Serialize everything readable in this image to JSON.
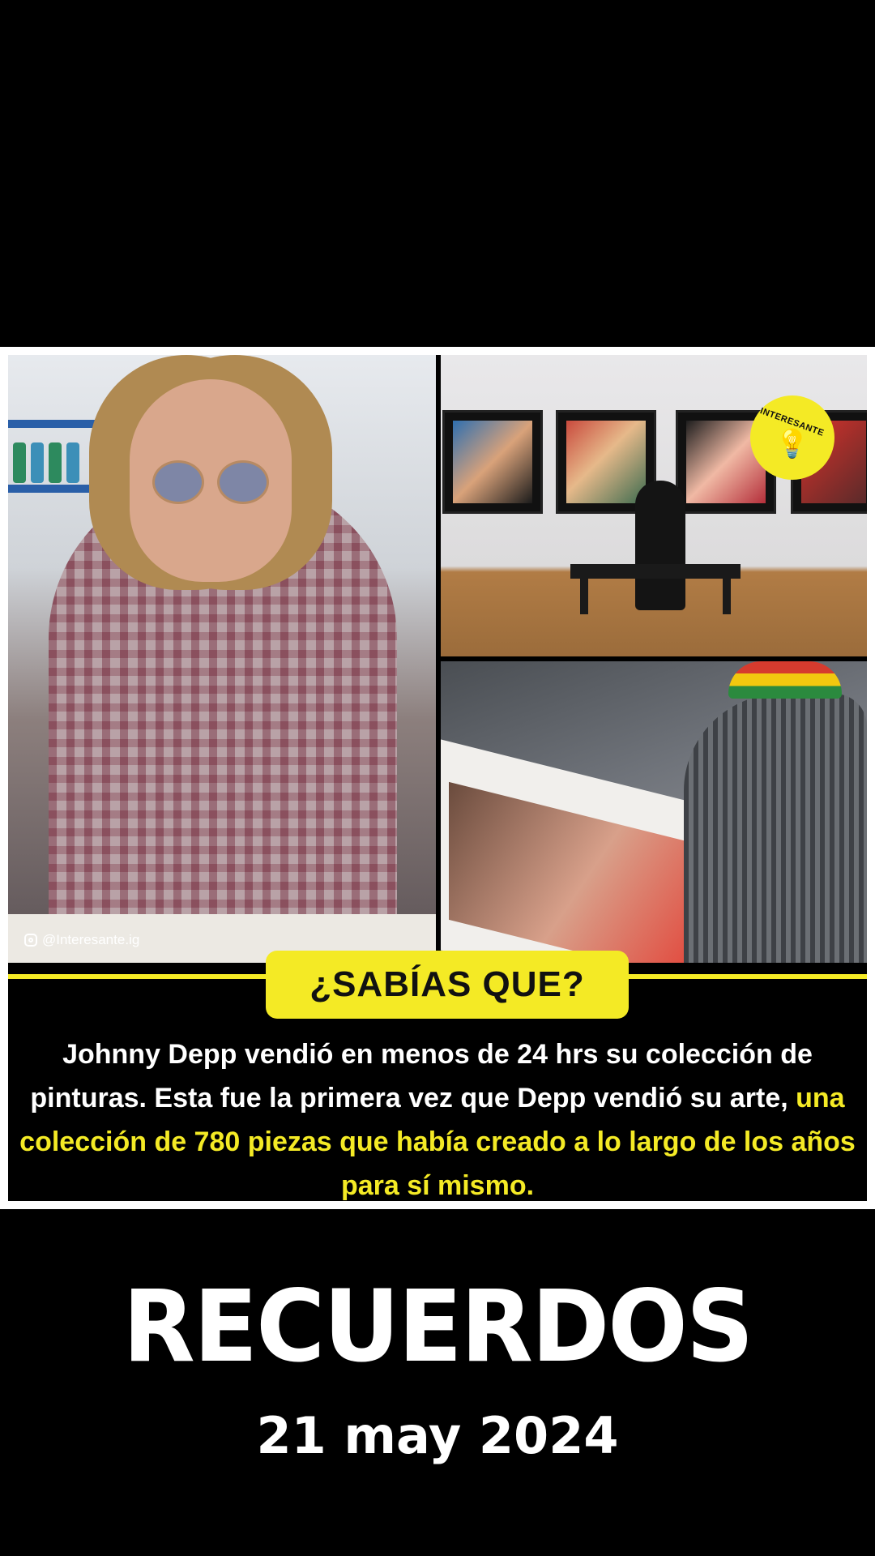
{
  "post": {
    "watermark_handle": "@Interesante.ig",
    "badge_text": "INTERESANTE",
    "banner_title": "¿SABÍAS QUE?",
    "body_text_plain": "Johnny Depp vendió en menos de 24 hrs su colección de pinturas. Esta fue la primera vez que Depp vendió su arte, ",
    "body_text_highlight": "una colección de 780 piezas que había creado a lo largo de los años para sí mismo.",
    "accent_color": "#f4ea25"
  },
  "caption": {
    "title": "RECUERDOS",
    "date": "21 may 2024"
  },
  "icons": [
    "instagram-icon",
    "lightbulb-icon"
  ]
}
